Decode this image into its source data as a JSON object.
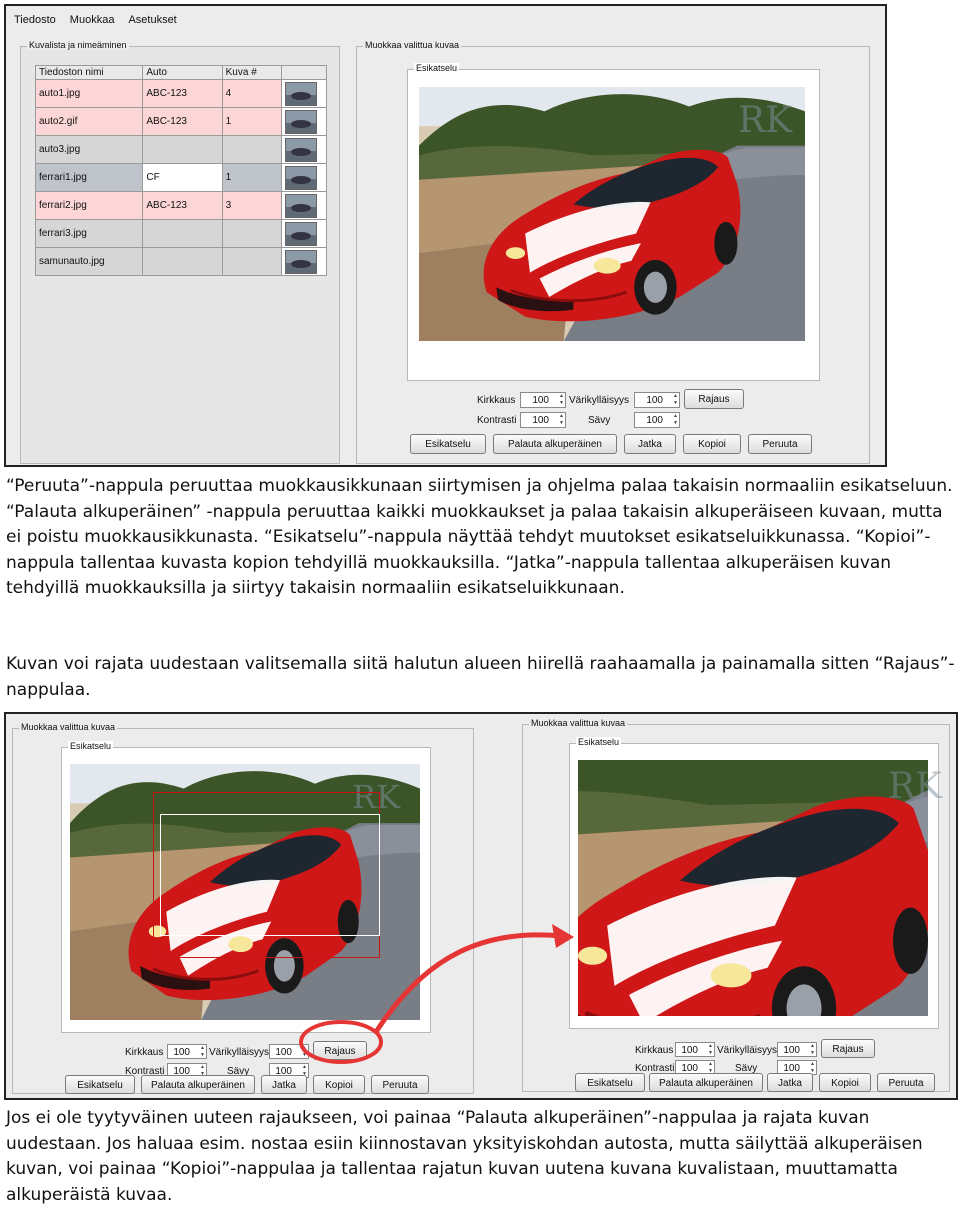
{
  "window1": {
    "menu": [
      "Tiedosto",
      "Muokkaa",
      "Asetukset"
    ],
    "list_group_title": "Kuvalista ja nimeäminen",
    "edit_group_title": "Muokkaa valittua kuvaa",
    "preview_group_title": "Esikatselu",
    "columns": [
      "Tiedoston nimi",
      "Auto",
      "Kuva #"
    ],
    "rows": [
      {
        "name": "auto1.jpg",
        "car": "ABC-123",
        "num": "4",
        "style": "pink"
      },
      {
        "name": "auto2.gif",
        "car": "ABC-123",
        "num": "1",
        "style": "pink"
      },
      {
        "name": "auto3.jpg",
        "car": "",
        "num": "",
        "style": "gray"
      },
      {
        "name": "ferrari1.jpg",
        "car": "CF",
        "num": "1",
        "style": "sel"
      },
      {
        "name": "ferrari2.jpg",
        "car": "ABC-123",
        "num": "3",
        "style": "pink"
      },
      {
        "name": "ferrari3.jpg",
        "car": "",
        "num": "",
        "style": "gray"
      },
      {
        "name": "samunauto.jpg",
        "car": "",
        "num": "",
        "style": "gray"
      }
    ]
  },
  "controls": {
    "kirkkaus_label": "Kirkkaus",
    "kirkkaus_value": "100",
    "varikyllaisyys_label": "Värikylläisyys",
    "varikyllaisyys_value": "100",
    "kontrasti_label": "Kontrasti",
    "kontrasti_value": "100",
    "savy_label": "Sävy",
    "savy_value": "100",
    "rajaus_button": "Rajaus",
    "esikatselu_button": "Esikatselu",
    "palauta_button": "Palauta alkuperäinen",
    "jatka_button": "Jatka",
    "kopioi_button": "Kopioi",
    "peruuta_button": "Peruuta"
  },
  "watermark": "RK",
  "paragraph1": "“Peruuta”-nappula peruuttaa muokkausikkunaan siirtymisen ja ohjelma palaa takaisin normaaliin esikatseluun. “Palauta alkuperäinen” -nappula peruuttaa kaikki muokkaukset ja palaa takaisin alkuperäiseen kuvaan, mutta ei poistu muokkausikkunasta. “Esikatselu”-nappula näyttää tehdyt muutokset esikatseluikkunassa. “Kopioi”-nappula tallentaa kuvasta kopion tehdyillä muokkauksilla. “Jatka”-nappula tallentaa alkuperäisen kuvan tehdyillä muokkauksilla ja siirtyy takaisin normaaliin esikatseluikkunaan.",
  "paragraph2": "Kuvan voi rajata uudestaan valitsemalla siitä halutun alueen hiirellä raahaamalla ja painamalla sitten “Rajaus”-nappulaa.",
  "paragraph3": "Jos ei ole tyytyväinen uuteen rajaukseen, voi painaa “Palauta alkuperäinen”-nappulaa ja rajata kuvan uudestaan. Jos haluaa esim. nostaa esiin kiinnostavan yksityiskohdan autosta, mutta säilyttää alkuperäisen kuvan, voi painaa “Kopioi”-nappulaa ja tallentaa rajatun kuvan uutena kuvana kuvalistaan, muuttamatta alkuperäistä kuvaa.",
  "colors": {
    "car_red": "#d81818",
    "road": "#767a84",
    "sky": "#dfe4ea",
    "trees": "#3a5a2a",
    "highlight_red": "#e53535"
  }
}
